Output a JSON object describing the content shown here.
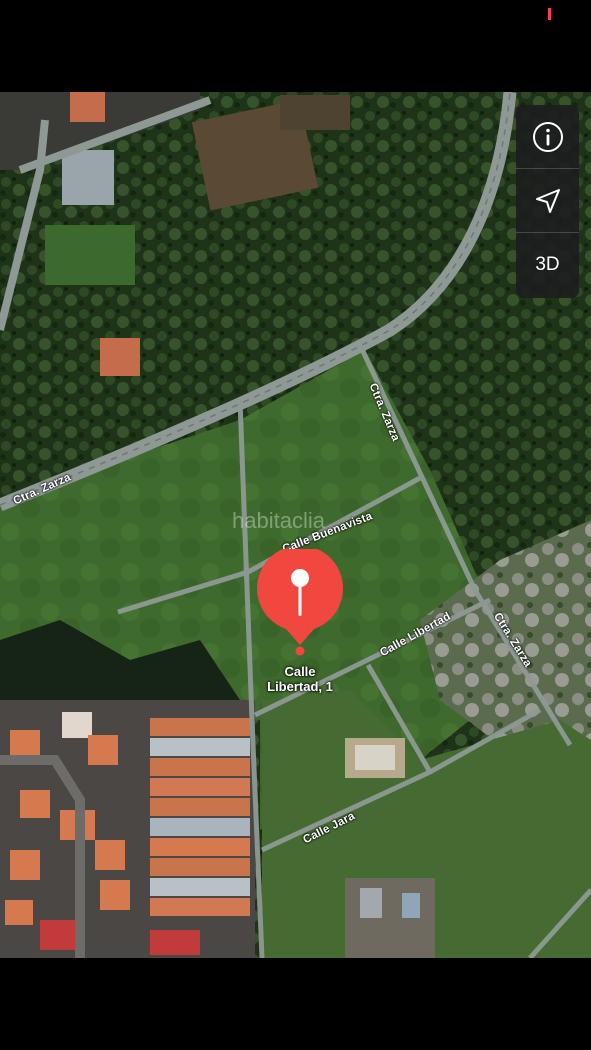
{
  "map": {
    "streets": {
      "ctra_zarza_main": "Ctra. Zarza",
      "ctra_zarza_upper": "Ctra. Zarza",
      "ctra_zarza_lower": "Ctra. Zarza",
      "calle_buenavista": "Calle Buenavista",
      "calle_libertad": "Calle Libertad",
      "calle_jara": "Calle Jara"
    },
    "pin": {
      "color": "#f0483e",
      "address_line1": "Calle",
      "address_line2": "Libertad, 1"
    },
    "watermark": "habitaclia"
  },
  "controls": {
    "info_icon": "info-icon",
    "location_icon": "location-arrow-icon",
    "threed_label": "3D"
  }
}
